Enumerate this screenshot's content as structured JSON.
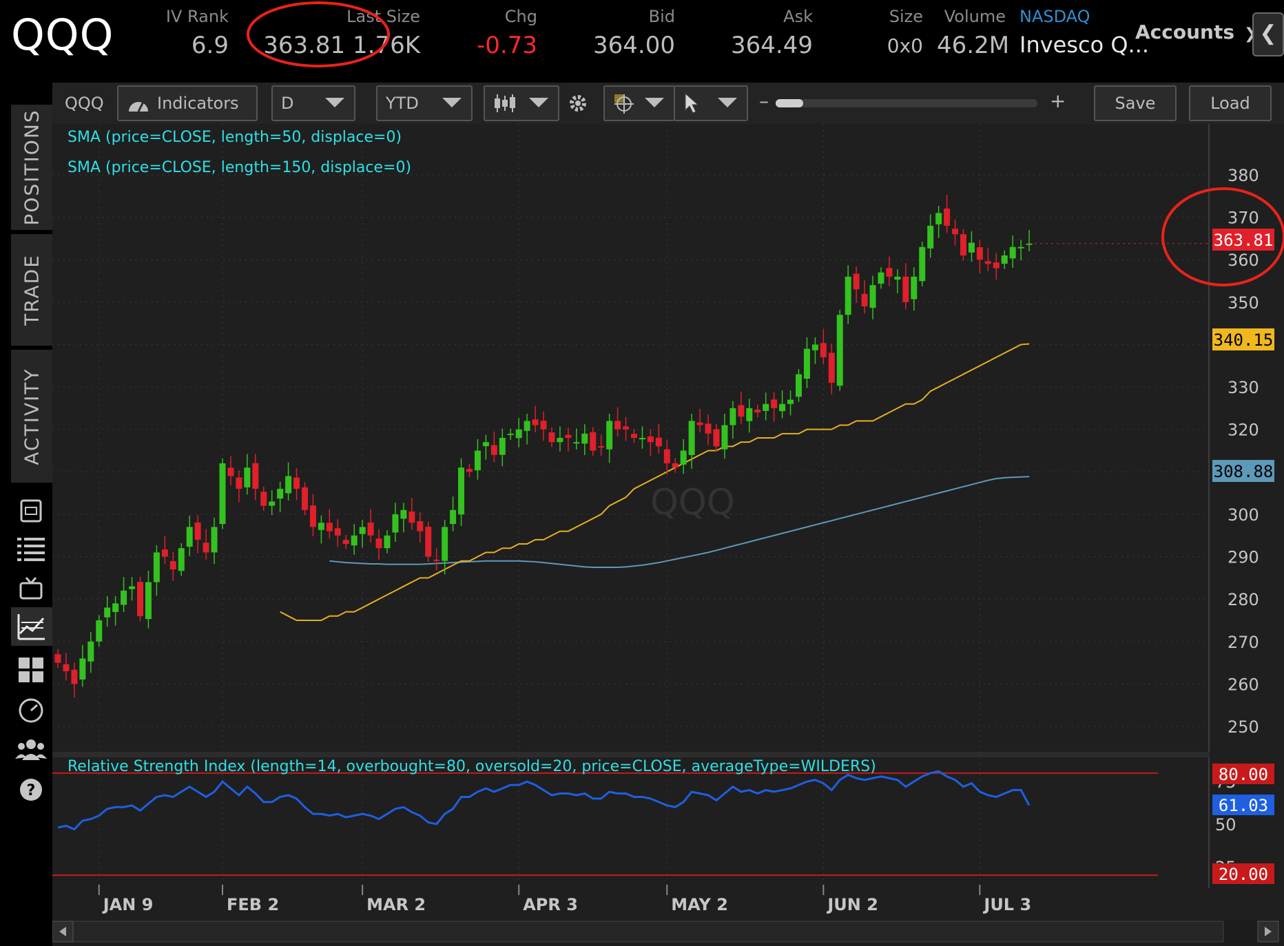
{
  "quote": {
    "symbol": "QQQ",
    "iv_rank_label": "IV Rank",
    "iv_rank": "6.9",
    "last_size_label": "Last Size",
    "last_size": "363.81 1.76K",
    "chg_label": "Chg",
    "chg": "-0.73",
    "bid_label": "Bid",
    "bid": "364.00",
    "ask_label": "Ask",
    "ask": "364.49",
    "size_label": "Size",
    "size": "0x0",
    "volume_label": "Volume",
    "volume": "46.2M",
    "exchange": "NASDAQ",
    "description": "Invesco Q...",
    "accounts_label": "Accounts"
  },
  "side_tabs": [
    "POSITIONS",
    "TRADE",
    "ACTIVITY"
  ],
  "rail_icons": [
    "monitor-icon",
    "list-icon",
    "tv-icon",
    "chart-icon",
    "grid-icon",
    "speedometer-icon",
    "people-icon",
    "help-icon"
  ],
  "toolbar": {
    "symbol": "QQQ",
    "indicators_label": "Indicators",
    "aggregation": "D",
    "time_frame": "YTD",
    "minus": "–",
    "plus": "+",
    "save_label": "Save",
    "load_label": "Load"
  },
  "colors": {
    "up": "#33c21f",
    "down": "#e0202a",
    "sma50": "#e6b020",
    "sma150": "#5c9ab8",
    "rsi": "#1f5fe0",
    "annotation": "#e8231a",
    "study_label": "#2ee0e6"
  },
  "chart_data": [
    {
      "type": "candlestick",
      "symbol": "QQQ",
      "watermark": "QQQ",
      "studies": [
        {
          "name": "SMA (price=CLOSE, length=50, displace=0)",
          "color": "#e6b020",
          "last": "340.15"
        },
        {
          "name": "SMA (price=CLOSE, length=150, displace=0)",
          "color": "#5c9ab8",
          "last": "308.88"
        }
      ],
      "ylim": [
        244,
        392
      ],
      "y_ticks": [
        "250",
        "260",
        "270",
        "280",
        "290",
        "300",
        "320",
        "330",
        "350",
        "360",
        "370",
        "380"
      ],
      "last_price": "363.81",
      "x_labels": [
        "JAN 9",
        "FEB 2",
        "MAR 2",
        "APR 3",
        "MAY 2",
        "JUN 2",
        "JUL 3"
      ],
      "x_label_index": [
        5,
        20,
        37,
        56,
        74,
        93,
        112
      ],
      "close": [
        265,
        263,
        260,
        266,
        270,
        275,
        278,
        279,
        282,
        283,
        276,
        284,
        291,
        290,
        287,
        292,
        297,
        294,
        291,
        297,
        312,
        309,
        306,
        311,
        306,
        302,
        303,
        306,
        309,
        306,
        301,
        297,
        298,
        296,
        295,
        293,
        295,
        297,
        295,
        292,
        295,
        300,
        301,
        298,
        296,
        290,
        289,
        297,
        301,
        311,
        310,
        315,
        317,
        314,
        318,
        319,
        320,
        322,
        321,
        320,
        317,
        318,
        318,
        317,
        319,
        315,
        316,
        322,
        320,
        320,
        318,
        318,
        317,
        316,
        312,
        311,
        315,
        322,
        321,
        319,
        316,
        321,
        325,
        323,
        325,
        324,
        326,
        325,
        326,
        327,
        333,
        339,
        340,
        337,
        331,
        347,
        356,
        353,
        349,
        354,
        357,
        356,
        356,
        350,
        356,
        363,
        368,
        371,
        368,
        366,
        361,
        364,
        360,
        359,
        358,
        361,
        363,
        363,
        363.81
      ],
      "sma50": [
        277,
        276,
        275,
        275,
        275,
        275,
        276,
        276,
        277,
        277,
        278,
        279,
        280,
        281,
        282,
        283,
        284,
        285,
        285,
        286,
        287,
        288,
        289,
        289,
        290,
        291,
        291,
        292,
        292,
        293,
        293,
        294,
        294,
        295,
        296,
        296,
        297,
        298,
        299,
        300,
        302,
        303,
        304,
        306,
        307,
        308,
        309,
        310,
        311,
        312,
        313,
        314,
        315,
        315,
        316,
        316,
        317,
        317,
        318,
        318,
        318,
        319,
        319,
        319,
        320,
        320,
        320,
        320,
        321,
        321,
        322,
        322,
        322,
        323,
        324,
        325,
        326,
        326,
        327,
        329,
        330,
        331,
        332,
        333,
        334,
        335,
        336,
        337,
        338,
        339,
        340,
        340.15
      ],
      "sma150": [
        289,
        288.8,
        288.6,
        288.5,
        288.4,
        288.3,
        288.3,
        288.2,
        288.2,
        288.2,
        288.2,
        288.2,
        288.3,
        288.4,
        288.5,
        288.6,
        288.7,
        288.8,
        288.9,
        289,
        289,
        289,
        289,
        289,
        288.9,
        288.8,
        288.6,
        288.4,
        288.2,
        288,
        287.8,
        287.6,
        287.5,
        287.5,
        287.5,
        287.5,
        287.6,
        287.8,
        288,
        288.3,
        288.6,
        289,
        289.4,
        289.8,
        290.2,
        290.6,
        291,
        291.5,
        292,
        292.5,
        293,
        293.5,
        294,
        294.5,
        295,
        295.5,
        296,
        296.5,
        297,
        297.5,
        298,
        298.5,
        299,
        299.5,
        300,
        300.5,
        301,
        301.5,
        302,
        302.5,
        303,
        303.5,
        304,
        304.5,
        305,
        305.5,
        306,
        306.5,
        307,
        307.5,
        308,
        308.4,
        308.6,
        308.7,
        308.8,
        308.88
      ],
      "sma150_start_index": 0
    },
    {
      "type": "line",
      "title": "Relative Strength Index (length=14, overbought=80, oversold=20, price=CLOSE, averageType=WILDERS)",
      "ylim": [
        14,
        86
      ],
      "overbought": "80.00",
      "oversold": "20.00",
      "last": "61.03",
      "y_ticks_partial": [
        "75",
        "50",
        "25"
      ],
      "values": [
        48,
        49,
        47,
        52,
        53,
        55,
        59,
        60,
        60,
        61,
        58,
        62,
        66,
        67,
        66,
        69,
        72,
        69,
        66,
        69,
        75,
        71,
        67,
        72,
        68,
        63,
        63,
        66,
        67,
        65,
        60,
        56,
        56,
        55,
        56,
        54,
        55,
        56,
        55,
        53,
        56,
        59,
        60,
        57,
        55,
        51,
        50,
        56,
        59,
        66,
        66,
        69,
        71,
        69,
        71,
        73,
        73,
        75,
        73,
        70,
        67,
        68,
        68,
        67,
        68,
        65,
        65,
        69,
        68,
        68,
        66,
        66,
        65,
        63,
        61,
        60,
        63,
        69,
        68,
        67,
        64,
        68,
        72,
        69,
        70,
        68,
        70,
        69,
        70,
        71,
        73,
        75,
        76,
        74,
        70,
        76,
        79,
        77,
        76,
        77,
        78,
        77,
        76,
        72,
        75,
        78,
        80,
        81,
        78,
        76,
        72,
        74,
        69,
        67,
        66,
        68,
        70,
        70,
        61.03
      ]
    }
  ]
}
